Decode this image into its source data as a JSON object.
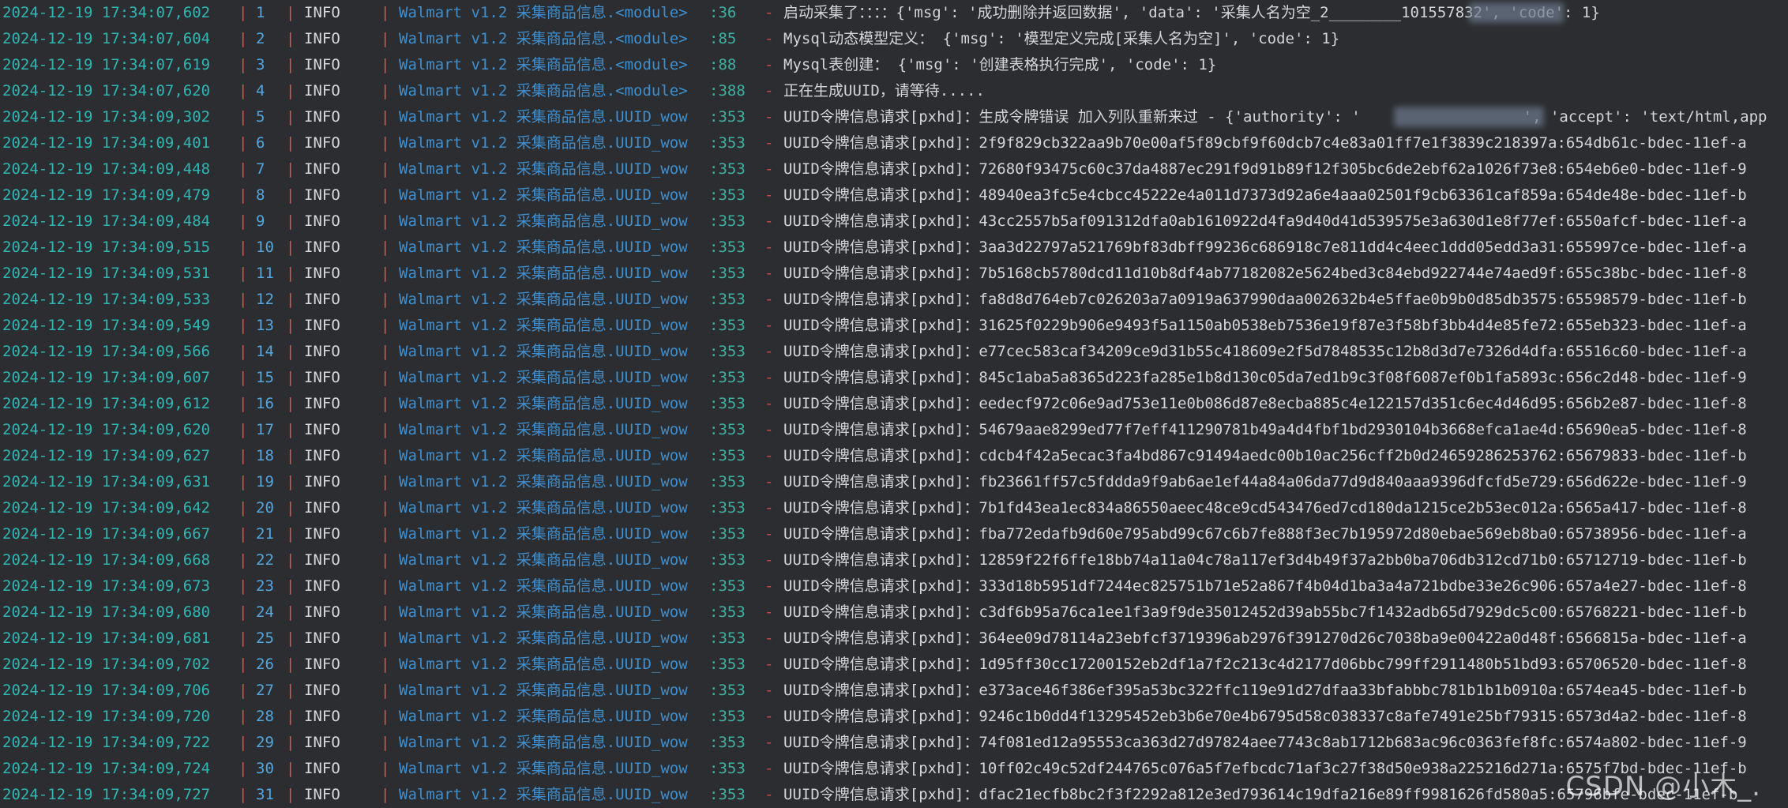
{
  "separators": {
    "pipe": "|",
    "dash": "-"
  },
  "level": "INFO",
  "module_prefix": "Walmart v1.2 采集商品信息.",
  "watermark": "CSDN @小木_.",
  "colors": {
    "background": "#2b2d30",
    "timestamp": "#2fb6b4",
    "separator": "#e0504f",
    "index": "#53a6de",
    "module": "#3f8fcf",
    "line_number": "#3fb0a2",
    "message": "#d3d5d8"
  },
  "lines": [
    {
      "ts": "2024-12-19 17:34:07,602",
      "n": "1",
      "mod": "<module>",
      "ln": ":36",
      "msg": "启动采集了：：：：{'msg': '成功删除并返回数据', 'data': '采集人名为空_2________101557832', 'code': 1}"
    },
    {
      "ts": "2024-12-19 17:34:07,604",
      "n": "2",
      "mod": "<module>",
      "ln": ":85",
      "msg": "Mysql动态模型定义： {'msg': '模型定义完成[采集人名为空]', 'code': 1}"
    },
    {
      "ts": "2024-12-19 17:34:07,619",
      "n": "3",
      "mod": "<module>",
      "ln": ":88",
      "msg": "Mysql表创建： {'msg': '创建表格执行完成', 'code': 1}"
    },
    {
      "ts": "2024-12-19 17:34:07,620",
      "n": "4",
      "mod": "<module>",
      "ln": ":388",
      "msg": "正在生成UUID，请等待....."
    },
    {
      "ts": "2024-12-19 17:34:09,302",
      "n": "5",
      "mod": "UUID_wow",
      "ln": ":353",
      "msg": "UUID令牌信息请求[pxhd]：生成令牌错误 加入列队重新来过 - {'authority': '                  ', 'accept': 'text/html,app"
    },
    {
      "ts": "2024-12-19 17:34:09,401",
      "n": "6",
      "mod": "UUID_wow",
      "ln": ":353",
      "msg": "UUID令牌信息请求[pxhd]：2f9f829cb322aa9b70e00af5f89cbf9f60dcb7c4e83a01ff7e1f3839c218397a:654db61c-bdec-11ef-a"
    },
    {
      "ts": "2024-12-19 17:34:09,448",
      "n": "7",
      "mod": "UUID_wow",
      "ln": ":353",
      "msg": "UUID令牌信息请求[pxhd]：72680f93475c60c37da4887ec291f9d91b89f12f305bc6de2ebf62a1026f73e8:654eb6e0-bdec-11ef-9"
    },
    {
      "ts": "2024-12-19 17:34:09,479",
      "n": "8",
      "mod": "UUID_wow",
      "ln": ":353",
      "msg": "UUID令牌信息请求[pxhd]：48940ea3fc5e4cbcc45222e4a011d7373d92a6e4aaa02501f9cb63361caf859a:654de48e-bdec-11ef-b"
    },
    {
      "ts": "2024-12-19 17:34:09,484",
      "n": "9",
      "mod": "UUID_wow",
      "ln": ":353",
      "msg": "UUID令牌信息请求[pxhd]：43cc2557b5af091312dfa0ab1610922d4fa9d40d41d539575e3a630d1e8f77ef:6550afcf-bdec-11ef-a"
    },
    {
      "ts": "2024-12-19 17:34:09,515",
      "n": "10",
      "mod": "UUID_wow",
      "ln": ":353",
      "msg": "UUID令牌信息请求[pxhd]：3aa3d22797a521769bf83dbff99236c686918c7e811dd4c4eec1ddd05edd3a31:655997ce-bdec-11ef-a"
    },
    {
      "ts": "2024-12-19 17:34:09,531",
      "n": "11",
      "mod": "UUID_wow",
      "ln": ":353",
      "msg": "UUID令牌信息请求[pxhd]：7b5168cb5780dcd11d10b8df4ab77182082e5624bed3c84ebd922744e74aed9f:655c38bc-bdec-11ef-8"
    },
    {
      "ts": "2024-12-19 17:34:09,533",
      "n": "12",
      "mod": "UUID_wow",
      "ln": ":353",
      "msg": "UUID令牌信息请求[pxhd]：fa8d8d764eb7c026203a7a0919a637990daa002632b4e5ffae0b9b0d85db3575:65598579-bdec-11ef-b"
    },
    {
      "ts": "2024-12-19 17:34:09,549",
      "n": "13",
      "mod": "UUID_wow",
      "ln": ":353",
      "msg": "UUID令牌信息请求[pxhd]：31625f0229b906e9493f5a1150ab0538eb7536e19f87e3f58bf3bb4d4e85fe72:655eb323-bdec-11ef-a"
    },
    {
      "ts": "2024-12-19 17:34:09,566",
      "n": "14",
      "mod": "UUID_wow",
      "ln": ":353",
      "msg": "UUID令牌信息请求[pxhd]：e77cec583caf34209ce9d31b55c418609e2f5d7848535c12b8d3d7e7326d4dfa:65516c60-bdec-11ef-a"
    },
    {
      "ts": "2024-12-19 17:34:09,607",
      "n": "15",
      "mod": "UUID_wow",
      "ln": ":353",
      "msg": "UUID令牌信息请求[pxhd]：845c1aba5a8365d223fa285e1b8d130c05da7ed1b9c3f08f6087ef0b1fa5893c:656c2d48-bdec-11ef-9"
    },
    {
      "ts": "2024-12-19 17:34:09,612",
      "n": "16",
      "mod": "UUID_wow",
      "ln": ":353",
      "msg": "UUID令牌信息请求[pxhd]：eedecf972c06e9ad753e11e0b086d87e8ecba885c4e122157d351c6ec4d46d95:656b2e87-bdec-11ef-8"
    },
    {
      "ts": "2024-12-19 17:34:09,620",
      "n": "17",
      "mod": "UUID_wow",
      "ln": ":353",
      "msg": "UUID令牌信息请求[pxhd]：54679aae8299ed77f7eff411290781b49a4d4fbf1bd2930104b3668efca1ae4d:65690ea5-bdec-11ef-8"
    },
    {
      "ts": "2024-12-19 17:34:09,627",
      "n": "18",
      "mod": "UUID_wow",
      "ln": ":353",
      "msg": "UUID令牌信息请求[pxhd]：cdcb4f42a5ecac3fa4bd867c91494aedc00b10ac256cff2b0d24659286253762:65679833-bdec-11ef-b"
    },
    {
      "ts": "2024-12-19 17:34:09,631",
      "n": "19",
      "mod": "UUID_wow",
      "ln": ":353",
      "msg": "UUID令牌信息请求[pxhd]：fb23661ff57c5fddda9f9ab6ae1ef44a84a06da77d9d840aaa9396dfcfd5e729:656d622e-bdec-11ef-9"
    },
    {
      "ts": "2024-12-19 17:34:09,642",
      "n": "20",
      "mod": "UUID_wow",
      "ln": ":353",
      "msg": "UUID令牌信息请求[pxhd]：7b1fd43ea1ec834a86550aeec48ce9cd543476ed7cd180da1215ce2b53ec012a:6565a417-bdec-11ef-8"
    },
    {
      "ts": "2024-12-19 17:34:09,667",
      "n": "21",
      "mod": "UUID_wow",
      "ln": ":353",
      "msg": "UUID令牌信息请求[pxhd]：fba772edafb9d60e795abd99c67c6b7fe888f3ec7b195972d80ebae569eb8ba0:65738956-bdec-11ef-a"
    },
    {
      "ts": "2024-12-19 17:34:09,668",
      "n": "22",
      "mod": "UUID_wow",
      "ln": ":353",
      "msg": "UUID令牌信息请求[pxhd]：12859f22f6ffe18bb74a11a04c78a117ef3d4b49f37a2bb0ba706db312cd71b0:65712719-bdec-11ef-b"
    },
    {
      "ts": "2024-12-19 17:34:09,673",
      "n": "23",
      "mod": "UUID_wow",
      "ln": ":353",
      "msg": "UUID令牌信息请求[pxhd]：333d18b5951df7244ec825751b71e52a867f4b04d1ba3a4a721bdbe33e26c906:657a4e27-bdec-11ef-8"
    },
    {
      "ts": "2024-12-19 17:34:09,680",
      "n": "24",
      "mod": "UUID_wow",
      "ln": ":353",
      "msg": "UUID令牌信息请求[pxhd]：c3df6b95a76ca1ee1f3a9f9de35012452d39ab55bc7f1432adb65d7929dc5c00:65768221-bdec-11ef-b"
    },
    {
      "ts": "2024-12-19 17:34:09,681",
      "n": "25",
      "mod": "UUID_wow",
      "ln": ":353",
      "msg": "UUID令牌信息请求[pxhd]：364ee09d78114a23ebfcf3719396ab2976f391270d26c7038ba9e00422a0d48f:6566815a-bdec-11ef-a"
    },
    {
      "ts": "2024-12-19 17:34:09,702",
      "n": "26",
      "mod": "UUID_wow",
      "ln": ":353",
      "msg": "UUID令牌信息请求[pxhd]：1d95ff30cc17200152eb2df1a7f2c213c4d2177d06bbc799ff2911480b51bd93:65706520-bdec-11ef-8"
    },
    {
      "ts": "2024-12-19 17:34:09,706",
      "n": "27",
      "mod": "UUID_wow",
      "ln": ":353",
      "msg": "UUID令牌信息请求[pxhd]：e373ace46f386ef395a53bc322ffc119e91d27dfaa33bfabbbc781b1b1b0910a:6574ea45-bdec-11ef-b"
    },
    {
      "ts": "2024-12-19 17:34:09,720",
      "n": "28",
      "mod": "UUID_wow",
      "ln": ":353",
      "msg": "UUID令牌信息请求[pxhd]：9246c1b0dd4f13295452eb3b6e70e4b6795d58c038337c8afe7491e25bf79315:6573d4a2-bdec-11ef-8"
    },
    {
      "ts": "2024-12-19 17:34:09,722",
      "n": "29",
      "mod": "UUID_wow",
      "ln": ":353",
      "msg": "UUID令牌信息请求[pxhd]：74f081ed12a95553ca363d27d97824aee7743c8ab1712b683ac96c0363fef8fc:6574a802-bdec-11ef-9"
    },
    {
      "ts": "2024-12-19 17:34:09,724",
      "n": "30",
      "mod": "UUID_wow",
      "ln": ":353",
      "msg": "UUID令牌信息请求[pxhd]：10ff02c49c52df244765c076a5f7efbcdc71af3c27f38d50e938a225216d271a:6575f7bd-bdec-11ef-b"
    },
    {
      "ts": "2024-12-19 17:34:09,727",
      "n": "31",
      "mod": "UUID_wow",
      "ln": ":353",
      "msg": "UUID令牌信息请求[pxhd]：dfac21ecfb8bc2f3f2292a812e3ed793614c19dfa216e89ff9981626fd580a5:65796bfe-bdec-11ef-b"
    }
  ]
}
